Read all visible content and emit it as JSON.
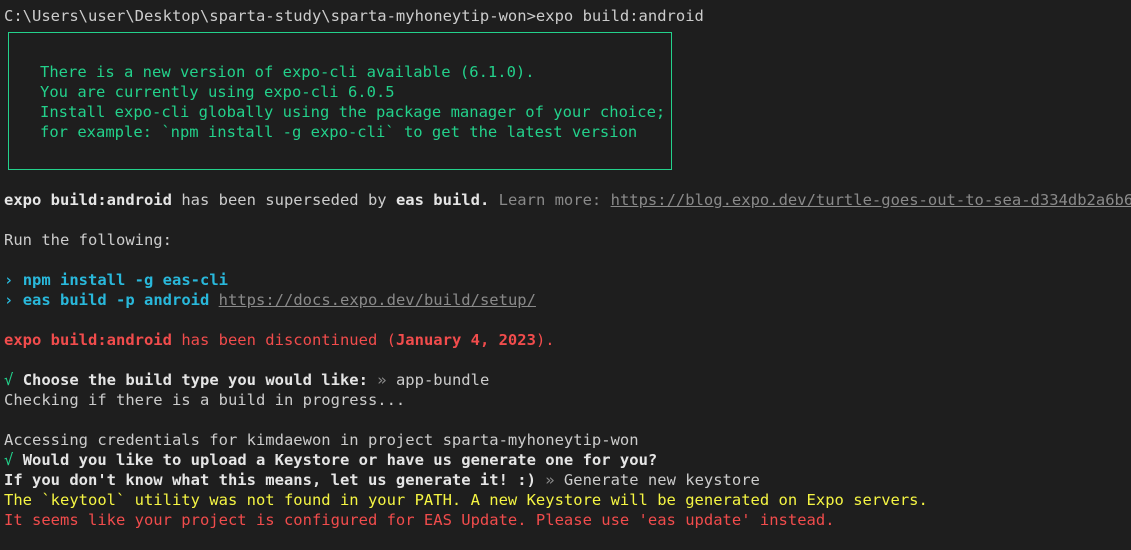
{
  "prompt": "C:\\Users\\user\\Desktop\\sparta-study\\sparta-myhoneytip-won>expo build:android",
  "update_box": [
    "There is a new version of expo-cli available (6.1.0).",
    "You are currently using expo-cli 6.0.5",
    "Install expo-cli globally using the package manager of your choice;",
    "for example: `npm install -g expo-cli` to get the latest version"
  ],
  "superseded": {
    "cmd": "expo build:android",
    "text": " has been superseded by ",
    "new_cmd": "eas build.",
    "learn": " Learn more: ",
    "url": "https://blog.expo.dev/turtle-goes-out-to-sea-d334db2a6b60"
  },
  "run_following": "Run the following:",
  "steps": {
    "arrow": "›",
    "step1": "npm install -g eas-cli",
    "step2": "eas build -p android",
    "step2_url": "https://docs.expo.dev/build/setup/"
  },
  "discontinued": {
    "cmd": "expo build:android",
    "text": " has been discontinued (",
    "date": "January 4, 2023",
    "end": ")."
  },
  "build_type": {
    "check": "√",
    "question": "Choose the build type you would like:",
    "sep": " » ",
    "answer": "app-bundle"
  },
  "checking": "Checking if there is a build in progress...",
  "accessing": "Accessing credentials for kimdaewon in project sparta-myhoneytip-won",
  "keystore": {
    "check": "√",
    "question": "Would you like to upload a Keystore or have us generate one for you?",
    "question2": "If you don't know what this means, let us generate it! :)",
    "sep": " » ",
    "answer": "Generate new keystore"
  },
  "keytool_warning": "The `keytool` utility was not found in your PATH. A new Keystore will be generated on Expo servers.",
  "eas_update_warning": "It seems like your project is configured for EAS Update. Please use 'eas update' instead.",
  "colors": {
    "background": "#1e1e1e",
    "green": "#23d18b",
    "cyan": "#29b8db",
    "red": "#f14c4c",
    "yellow": "#f5f543"
  }
}
